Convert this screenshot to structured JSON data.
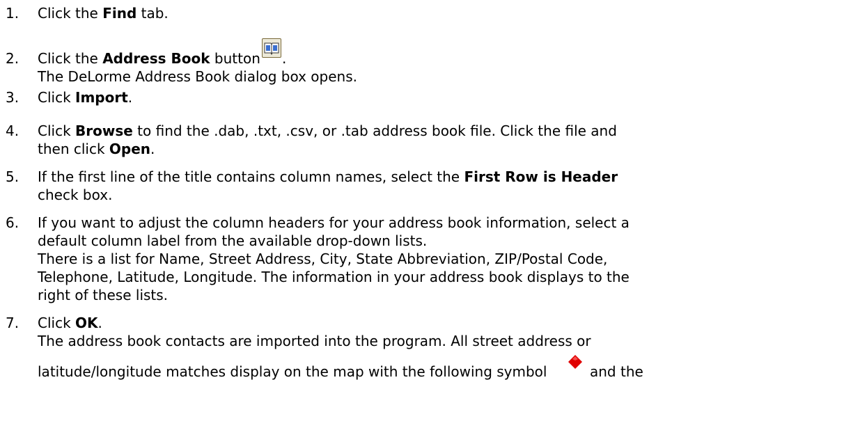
{
  "steps": [
    {
      "num": "1.",
      "pre": "Click the ",
      "bold": "Find",
      "post": " tab."
    },
    {
      "num": "2.",
      "pre": "Click the ",
      "bold": "Address Book",
      "post": " button",
      "end": ".",
      "line2": "The DeLorme Address Book dialog box opens."
    },
    {
      "num": "3.",
      "pre": "Click ",
      "bold": "Import",
      "post": "."
    },
    {
      "num": "4.",
      "pre": "Click ",
      "bold": "Browse",
      "post": " to find the .dab, .txt, .csv, or .tab address book file. Click the file and",
      "line2_pre": "then click ",
      "line2_bold": "Open",
      "line2_post": "."
    },
    {
      "num": "5.",
      "pre": "If the first line of the title contains column names, select the ",
      "bold": "First Row is Header",
      "line2": "check box."
    },
    {
      "num": "6.",
      "line1": "If you want to adjust the column headers for your address book information, select a",
      "line2": "default column label from the available drop-down lists.",
      "line3": "There is a list for Name, Street Address, City, State Abbreviation, ZIP/Postal Code,",
      "line4": "Telephone, Latitude, Longitude. The information in your address book displays to the",
      "line5": "right of these lists."
    },
    {
      "num": "7.",
      "pre": "Click ",
      "bold": "OK",
      "post": ".",
      "line2": "The address book contacts are imported into the program. All street address or",
      "line3_pre": "latitude/longitude matches display on the map with the following symbol",
      "line3_post": "and the"
    }
  ],
  "icons": {
    "address_book_button": "address-book-icon",
    "map_symbol": "red-diamond-icon",
    "symbol_color": "#e00000"
  }
}
